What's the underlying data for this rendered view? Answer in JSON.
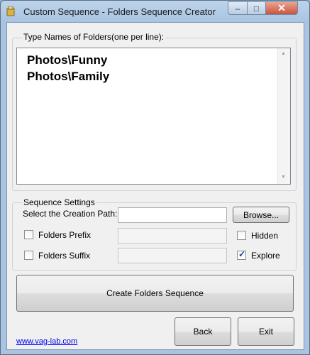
{
  "window": {
    "title": "Custom Sequence - Folders Sequence Creator"
  },
  "names_group": {
    "label": "Type Names of Folders(one per line):",
    "lines": [
      "Photos\\Funny",
      "Photos\\Family"
    ]
  },
  "settings": {
    "group_label": "Sequence Settings",
    "creation_path_label": "Select the Creation Path:",
    "creation_path_value": "",
    "browse_label": "Browse...",
    "prefix_label": "Folders Prefix",
    "prefix_checked": false,
    "suffix_label": "Folders Suffix",
    "suffix_checked": false,
    "hidden_label": "Hidden",
    "hidden_checked": false,
    "explore_label": "Explore",
    "explore_checked": true
  },
  "actions": {
    "create_label": "Create Folders Sequence",
    "back_label": "Back",
    "exit_label": "Exit"
  },
  "footer": {
    "link_text": "www.vag-lab.com"
  }
}
